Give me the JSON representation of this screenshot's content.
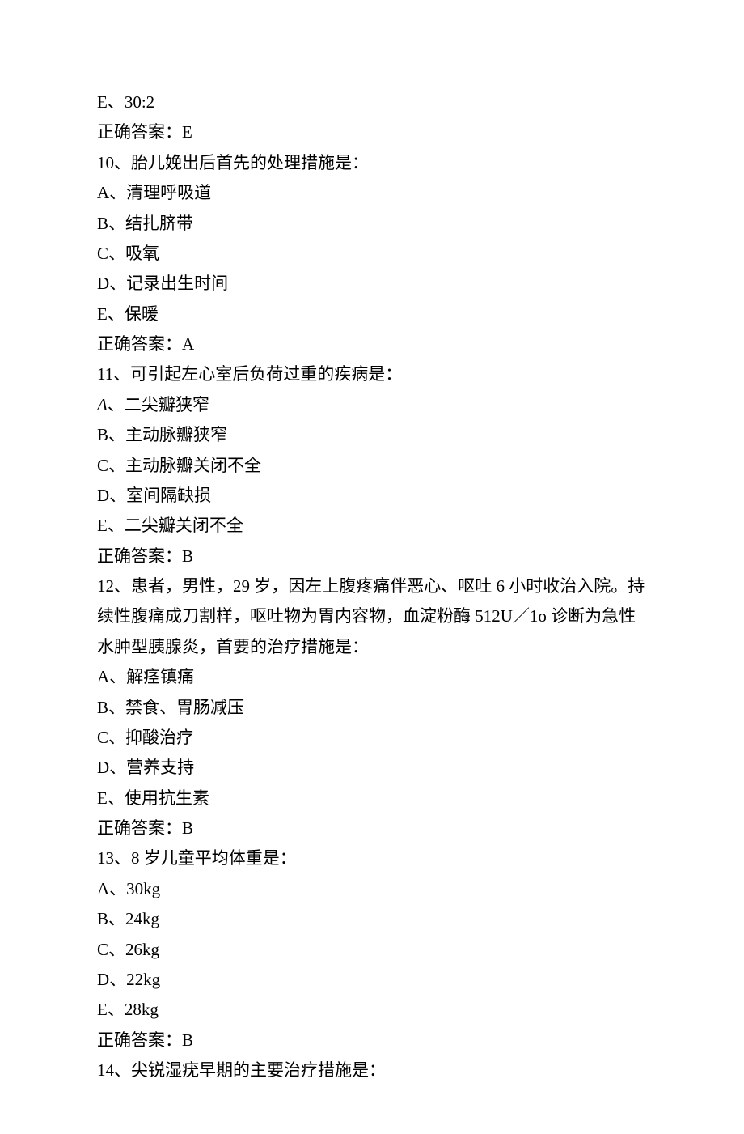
{
  "lines": [
    {
      "text": "E、30:2"
    },
    {
      "text": "正确答案：E"
    },
    {
      "text": "10、胎儿娩出后首先的处理措施是："
    },
    {
      "text": "A、清理呼吸道"
    },
    {
      "text": "B、结扎脐带"
    },
    {
      "text": "C、吸氧"
    },
    {
      "text": "D、记录出生时间"
    },
    {
      "text": "E、保暖"
    },
    {
      "text": "正确答案：A"
    },
    {
      "text": "11、可引起左心室后负荷过重的疾病是："
    },
    {
      "prefix": "A",
      "prefixItalic": true,
      "rest": "、二尖瓣狭窄"
    },
    {
      "text": "B、主动脉瓣狭窄"
    },
    {
      "text": "C、主动脉瓣关闭不全"
    },
    {
      "text": "D、室间隔缺损"
    },
    {
      "text": "E、二尖瓣关闭不全"
    },
    {
      "text": "正确答案：B"
    },
    {
      "text": "12、患者，男性，29 岁，因左上腹疼痛伴恶心、呕吐 6 小时收治入院。持续性腹痛成刀割样，呕吐物为胃内容物，血淀粉酶 512U／1o 诊断为急性水肿型胰腺炎，首要的治疗措施是："
    },
    {
      "text": "A、解痉镇痛"
    },
    {
      "text": "B、禁食、胃肠减压"
    },
    {
      "text": "C、抑酸治疗"
    },
    {
      "text": "D、营养支持"
    },
    {
      "text": "E、使用抗生素"
    },
    {
      "text": "正确答案：B"
    },
    {
      "text": "13、8 岁儿童平均体重是："
    },
    {
      "text": "A、30kg"
    },
    {
      "text": "B、24kg"
    },
    {
      "text": "C、26kg"
    },
    {
      "text": "D、22kg"
    },
    {
      "text": "E、28kg"
    },
    {
      "text": "正确答案：B"
    },
    {
      "text": "14、尖锐湿疣早期的主要治疗措施是："
    }
  ]
}
